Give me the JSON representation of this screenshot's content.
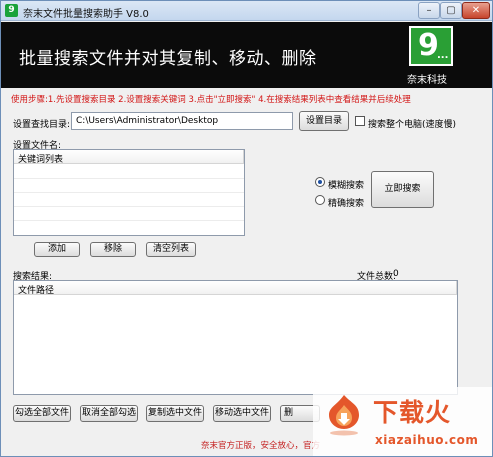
{
  "window": {
    "title": "奈末文件批量搜索助手 V8.0",
    "icon_glyph": "9",
    "minimize_glyph": "–",
    "maximize_glyph": "▢",
    "close_glyph": "✕"
  },
  "banner": {
    "title": "批量搜索文件并对其复制、移动、删除",
    "logo_glyph": "9",
    "logo_dots": "...",
    "logo_name": "奈末科技"
  },
  "steps": "使用步骤:1.先设置搜索目录 2.设置搜索关键词 3.点击\"立即搜索\" 4.在搜索结果列表中查看结果并后续处理",
  "search_dir": {
    "label": "设置查找目录:",
    "value": "C:\\Users\\Administrator\\Desktop",
    "button": "设置目录",
    "search_all_label": "搜索整个电脑(速度慢)"
  },
  "filename": {
    "label": "设置文件名:",
    "column_header": "关键词列表"
  },
  "mode": {
    "fuzzy_label": "模糊搜索",
    "exact_label": "精确搜索"
  },
  "actions": {
    "search_now": "立即搜索",
    "add": "添加",
    "remove": "移除",
    "clear": "清空列表"
  },
  "results": {
    "label": "搜索结果:",
    "total_label": "文件总数:",
    "total_value": "0",
    "column_header": "文件路径"
  },
  "bottom_buttons": {
    "select_all": "勾选全部文件",
    "deselect_all": "取消全部勾选",
    "copy_selected": "复制选中文件",
    "move_selected": "移动选中文件",
    "delete_partial": "删"
  },
  "footer": "奈末官方正版，安全放心，官方",
  "watermark": {
    "main": "下载火",
    "url": "xiazaihuo.com"
  },
  "colors": {
    "accent_red": "#d21515",
    "logo_green": "#2a9f35",
    "watermark_orange": "#e4572b"
  }
}
